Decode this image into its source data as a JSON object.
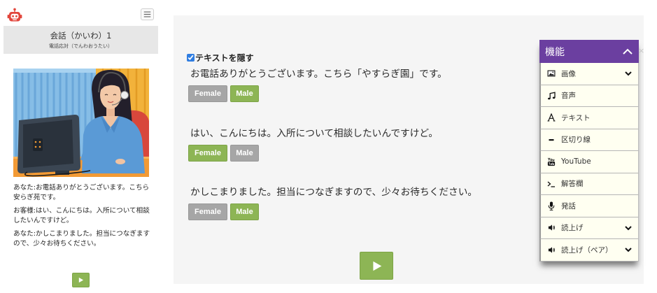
{
  "sidebar": {
    "logo_icon": "robot-icon",
    "menu_icon": "hamburger-menu-icon",
    "lesson_title": "会話（かいわ）1",
    "lesson_subtitle": "電話応対（でんわおうたい）",
    "dialogue": [
      "あなた:お電話ありがとうございます。こちら安らぎ苑です。",
      "お客様:はい、こんにちは。入所について相談したいんですけど。",
      "あなた:かしこまりました。担当につなぎますので、少々お待ちください。"
    ],
    "play_icon": "play-icon"
  },
  "main": {
    "hide_text_label": "テキストを隠す",
    "hide_text_checked": true,
    "lines": [
      {
        "text": "お電話ありがとうございます。こちら「やすらぎ園」です。",
        "female_label": "Female",
        "male_label": "Male",
        "active_voice": "male"
      },
      {
        "text": "はい、こんにちは。入所について相談したいんですけど。",
        "female_label": "Female",
        "male_label": "Male",
        "active_voice": "female"
      },
      {
        "text": "かしこまりました。担当につなぎますので、少々お待ちください。",
        "female_label": "Female",
        "male_label": "Male",
        "active_voice": "male"
      }
    ],
    "play_icon": "play-icon"
  },
  "features_panel": {
    "title": "機能",
    "collapse_icon": "chevron-up-icon",
    "close_label": "×",
    "items": [
      {
        "label": "画像",
        "icon": "image-icon",
        "has_submenu": true
      },
      {
        "label": "音声",
        "icon": "music-note-icon",
        "has_submenu": false
      },
      {
        "label": "テキスト",
        "icon": "text-icon",
        "has_submenu": false
      },
      {
        "label": "区切り線",
        "icon": "divider-icon",
        "has_submenu": false
      },
      {
        "label": "YouTube",
        "icon": "youtube-icon",
        "has_submenu": false
      },
      {
        "label": "解答欄",
        "icon": "terminal-icon",
        "has_submenu": false
      },
      {
        "label": "発話",
        "icon": "microphone-icon",
        "has_submenu": false
      },
      {
        "label": "読上げ",
        "icon": "volume-icon",
        "has_submenu": true
      },
      {
        "label": "読上げ（ペア）",
        "icon": "volume-icon",
        "has_submenu": true
      }
    ]
  },
  "colors": {
    "accent_green": "#8db555",
    "inactive_gray": "#a6a6a6",
    "panel_purple": "#6b3fa0",
    "logo_red": "#e2463c"
  }
}
